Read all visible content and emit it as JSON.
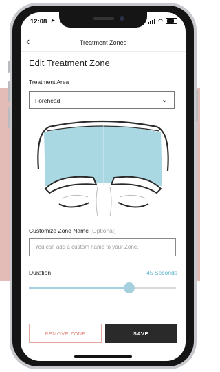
{
  "status_bar": {
    "time": "12:08"
  },
  "nav": {
    "title": "Treatment Zones"
  },
  "page": {
    "title": "Edit Treatment Zone"
  },
  "treatment_area": {
    "label": "Treatment Area",
    "selected": "Forehead"
  },
  "zone_name": {
    "label": "Customize Zone Name",
    "optional_label": "(Optional)",
    "placeholder": "You can add a custom name to your Zone.",
    "value": ""
  },
  "duration": {
    "label": "Duration",
    "value_text": "45 Seconds",
    "slider_fraction": 0.68
  },
  "buttons": {
    "remove": "REMOVE ZONE",
    "save": "SAVE"
  },
  "colors": {
    "accent": "#5fb3c9",
    "zone_fill": "#a9d7e2",
    "backdrop": "#e3bcb7",
    "remove_border": "#e5a9a1",
    "save_bg": "#2a2a2a"
  },
  "icons": {
    "back": "chevron-left-icon",
    "dropdown": "chevron-down-icon"
  }
}
